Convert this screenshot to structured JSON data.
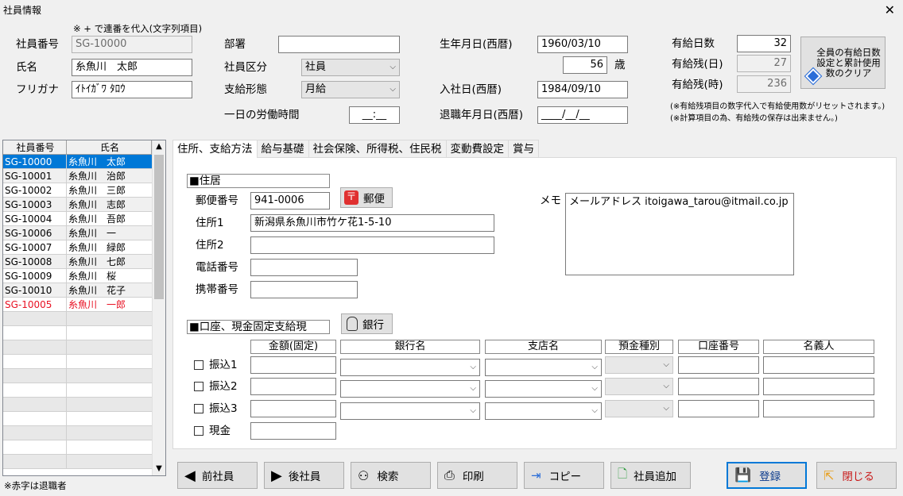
{
  "window": {
    "title": "社員情報",
    "close": "✕"
  },
  "header": {
    "note": "※ + で連番を代入(文字列項目)",
    "emp_no_label": "社員番号",
    "emp_no": "SG-10000",
    "name_label": "氏名",
    "name": "糸魚川　太郎",
    "kana_label": "フリガナ",
    "kana": "ｲﾄｲｶﾞﾜ ﾀﾛｳ",
    "dept_label": "部署",
    "dept": "",
    "category_label": "社員区分",
    "category": "社員",
    "pay_label": "支給形態",
    "pay": "月給",
    "hours_label": "一日の労働時間",
    "hours": "__:__",
    "birth_label": "生年月日(西暦)",
    "birth": "1960/03/10",
    "age": "56",
    "age_unit": "歳",
    "join_label": "入社日(西暦)",
    "join": "1984/09/10",
    "retire_label": "退職年月日(西暦)",
    "retire": "____/__/__",
    "leave_days_label": "有給日数",
    "leave_days": "32",
    "leave_rem_day_label": "有給残(日)",
    "leave_rem_day": "27",
    "leave_rem_hour_label": "有給残(時)",
    "leave_rem_hour": "236",
    "clear_button": "全員の有給日数設定と累計使用数のクリア",
    "note2": "(※有給残項目の数字代入で有給使用数がリセットされます。)",
    "note3": "(※計算項目の為、有給残の保存は出来ません。)"
  },
  "grid": {
    "col1": "社員番号",
    "col2": "氏名",
    "rows": [
      {
        "no": "SG-10000",
        "name": "糸魚川　太郎",
        "state": "selected"
      },
      {
        "no": "SG-10001",
        "name": "糸魚川　治郎",
        "state": "normal"
      },
      {
        "no": "SG-10002",
        "name": "糸魚川　三郎",
        "state": "normal"
      },
      {
        "no": "SG-10003",
        "name": "糸魚川　志郎",
        "state": "normal"
      },
      {
        "no": "SG-10004",
        "name": "糸魚川　吾郎",
        "state": "normal"
      },
      {
        "no": "SG-10006",
        "name": "糸魚川　一",
        "state": "normal"
      },
      {
        "no": "SG-10007",
        "name": "糸魚川　緑郎",
        "state": "normal"
      },
      {
        "no": "SG-10008",
        "name": "糸魚川　七郎",
        "state": "normal"
      },
      {
        "no": "SG-10009",
        "name": "糸魚川　桜",
        "state": "normal"
      },
      {
        "no": "SG-10010",
        "name": "糸魚川　花子",
        "state": "normal"
      },
      {
        "no": "SG-10005",
        "name": "糸魚川　一郎",
        "state": "retired"
      }
    ],
    "footnote": "※赤字は退職者"
  },
  "tabs": [
    "住所、支給方法",
    "給与基礎",
    "社会保険、所得税、住民税",
    "変動費設定",
    "賞与"
  ],
  "address": {
    "section": "■住居",
    "zip_label": "郵便番号",
    "zip": "941-0006",
    "zip_button": "郵便",
    "addr1_label": "住所1",
    "addr1": "新潟県糸魚川市竹ケ花1-5-10",
    "addr2_label": "住所2",
    "addr2": "",
    "tel_label": "電話番号",
    "tel": "",
    "mobile_label": "携帯番号",
    "mobile": "",
    "memo_label": "メモ",
    "memo": "メールアドレス itoigawa_tarou@itmail.co.jp"
  },
  "bank": {
    "section": "■口座、現金固定支給現",
    "bank_button": "銀行",
    "headers": [
      "金額(固定)",
      "銀行名",
      "支店名",
      "預金種別",
      "口座番号",
      "名義人"
    ],
    "rows": [
      {
        "label": "振込1"
      },
      {
        "label": "振込2"
      },
      {
        "label": "振込3"
      },
      {
        "label": "現金"
      }
    ]
  },
  "footer": {
    "prev": "前社員",
    "next": "後社員",
    "search": "検索",
    "print": "印刷",
    "copy": "コピー",
    "add": "社員追加",
    "save": "登録",
    "close": "閉じる"
  },
  "colors": {
    "selected": "#0078d7",
    "retired": "#e81123",
    "save_border": "#0078d7"
  }
}
